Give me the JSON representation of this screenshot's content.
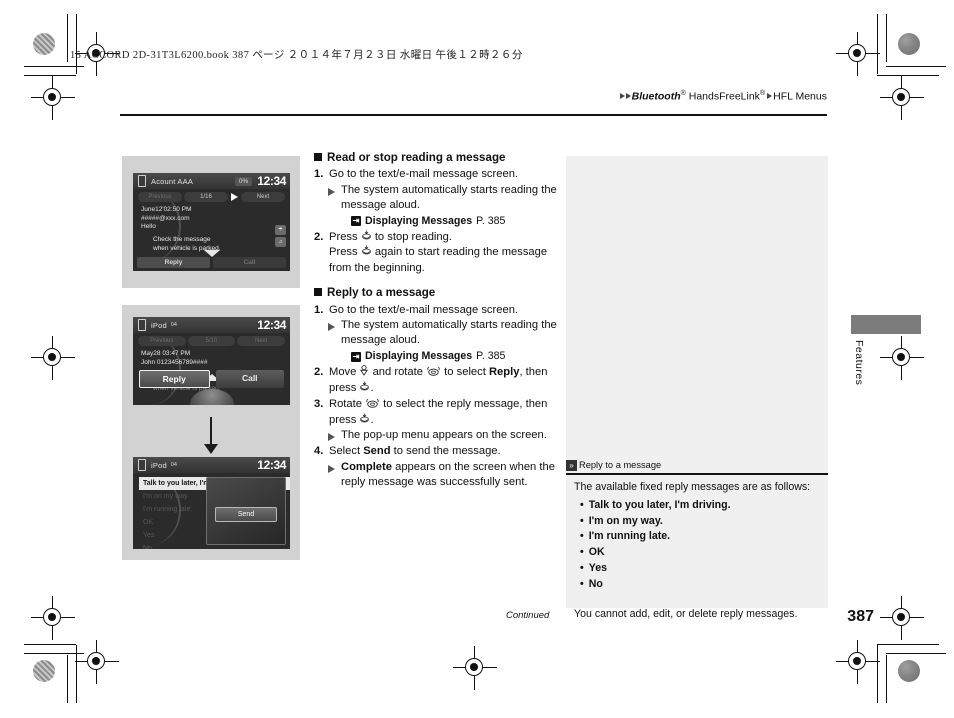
{
  "print_meta": {
    "line": "15 ACCORD 2D-31T3L6200.book   387 ページ   ２０１４年７月２３日   水曜日   午後１２時２６分"
  },
  "running_head": {
    "bluetooth": "Bluetooth",
    "sup1": "®",
    "handsfree": " HandsFreeLink",
    "sup2": "®",
    "section": "HFL Menus"
  },
  "sections": [
    {
      "heading": "Read or stop reading a message",
      "steps": [
        {
          "num": "1.",
          "text": "Go to the text/e-mail message screen.",
          "sub": [
            "The system automatically starts reading the message aloud."
          ],
          "xref": {
            "label": "Displaying Messages",
            "page": "P. 385"
          }
        },
        {
          "num": "2.",
          "text_pre": "Press ",
          "text_post": " to stop reading.",
          "text_line2_pre": "Press ",
          "text_line2_post": " again to start reading the message from the beginning."
        }
      ]
    },
    {
      "heading": "Reply to a message",
      "steps": [
        {
          "num": "1.",
          "text": "Go to the text/e-mail message screen.",
          "sub": [
            "The system automatically starts reading the message aloud."
          ],
          "xref": {
            "label": "Displaying Messages",
            "page": "P. 385"
          }
        },
        {
          "num": "2.",
          "text_a": "Move ",
          "text_b": " and rotate ",
          "text_c": " to select ",
          "bold": "Reply",
          "text_d": ", then press ",
          "text_e": "."
        },
        {
          "num": "3.",
          "text_a": "Rotate ",
          "text_b": " to select the reply message, then press ",
          "text_c": ".",
          "sub": [
            "The pop-up menu appears on the screen."
          ]
        },
        {
          "num": "4.",
          "text_a": "Select ",
          "bold": "Send",
          "text_b": " to send the message.",
          "sub_bold": "Complete",
          "sub_rest": " appears on the screen when the reply message was successfully sent."
        }
      ]
    }
  ],
  "note": {
    "title": "Reply to a message",
    "intro": "The available fixed reply messages are as follows:",
    "items": [
      "Talk to you later, I'm driving.",
      "I'm on my way.",
      "I'm running late.",
      "OK",
      "Yes",
      "No"
    ],
    "tail": "You cannot add, edit, or delete reply messages."
  },
  "side_tab": {
    "label": "Features"
  },
  "footer": {
    "continued": "Continued",
    "page_number": "387"
  },
  "screens": {
    "one": {
      "device": "Acount AAA",
      "signal": "",
      "battery": "0%",
      "clock": "12:34",
      "tab_prev": "Previous",
      "tab_count": "1/16",
      "tab_next": "Next",
      "lines": [
        "June12'02:50 PM",
        "#####@xxx.com",
        "Hello"
      ],
      "note1": "Check the message",
      "note2": "when vehicle is parked.",
      "btn_reply": "Reply",
      "btn_call": "Call"
    },
    "two": {
      "device": "iPod",
      "signal": "04",
      "clock": "12:34",
      "tab_prev": "Previous",
      "tab_count": "5/10",
      "tab_next": "Next",
      "lines": [
        "May28 03:47 PM",
        "John 0123456789####"
      ],
      "note1": "Check the message",
      "note2": "when vehicle is parked.",
      "btn_reply": "Reply",
      "btn_call": "Call"
    },
    "three": {
      "device": "iPod",
      "signal": "04",
      "clock": "12:34",
      "replies": [
        "Talk to you later, I'm",
        "I'm on my way.",
        "I'm running late.",
        "OK",
        "Yes",
        "No"
      ],
      "popup_send": "Send"
    }
  },
  "colors": {
    "panel_bg": "#d2d2d2",
    "note_bg": "#f0f0f0",
    "tab_gray": "#7c7c7c",
    "screen_dark": "#2b2b2b"
  }
}
